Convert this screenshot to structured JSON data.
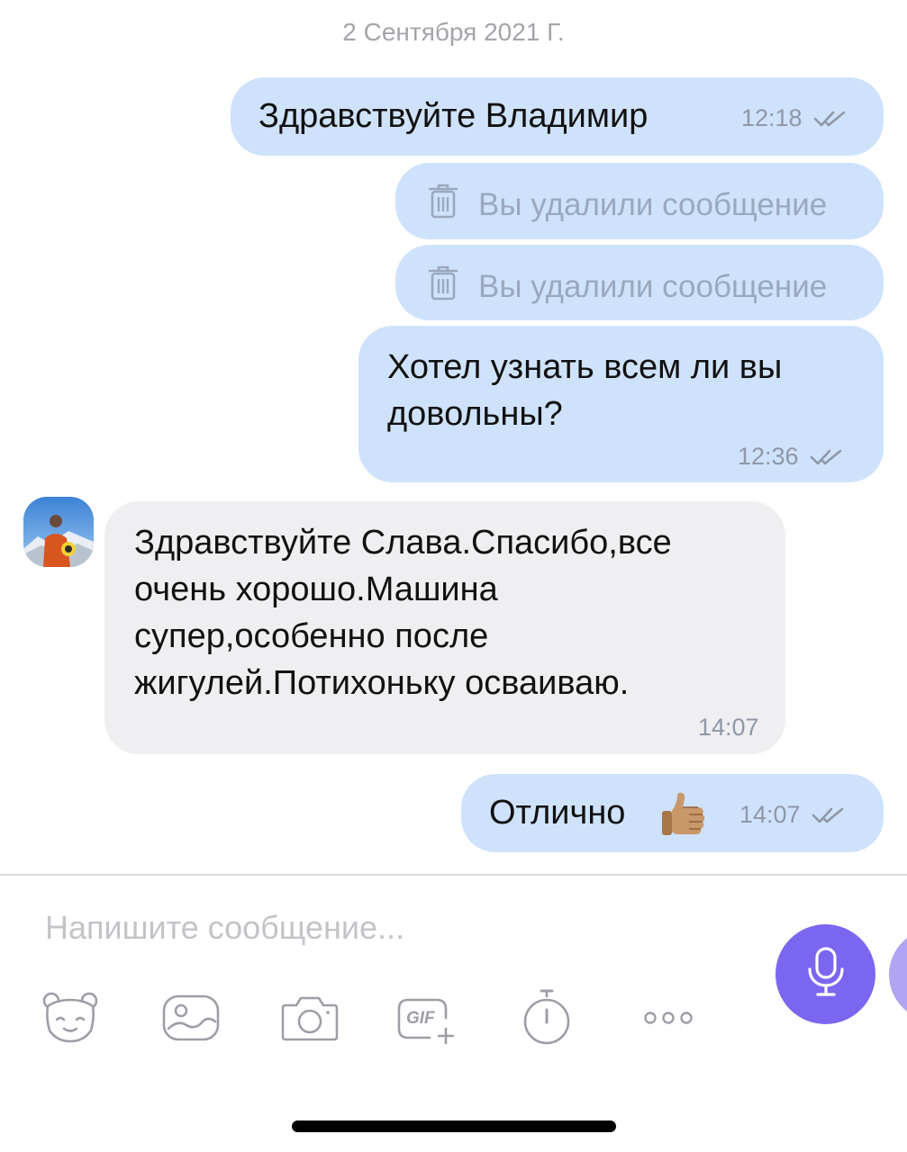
{
  "chat": {
    "date": "2 Сентября 2021 Г.",
    "messages": [
      {
        "direction": "out",
        "text": "Здравствуйте Владимир",
        "time": "12:18",
        "status": "read"
      },
      {
        "direction": "out",
        "deleted": true,
        "text": "Вы удалили сообщение"
      },
      {
        "direction": "out",
        "deleted": true,
        "text": "Вы удалили сообщение"
      },
      {
        "direction": "out",
        "lines": [
          "Хотел узнать всем ли вы",
          "довольны?"
        ],
        "time": "12:36",
        "status": "read"
      },
      {
        "direction": "in",
        "lines": [
          "Здравствуйте Слава.Спасибо,все",
          "очень хорошо.Машина",
          "супер,особенно после",
          "жигулей.Потихоньку осваиваю."
        ],
        "time": "14:07"
      },
      {
        "direction": "out",
        "text": "Отлично",
        "emoji": "thumbs-up",
        "time": "14:07",
        "status": "read"
      }
    ]
  },
  "composer": {
    "placeholder": "Напишите сообщение...",
    "toolbar": [
      "sticker-icon",
      "gallery-icon",
      "camera-icon",
      "gif-icon",
      "timer-icon",
      "more-icon"
    ],
    "gif_label": "GIF",
    "mic": "microphone-icon"
  },
  "colors": {
    "outgoing_bubble": "#cfe2fc",
    "incoming_bubble": "#efeff1",
    "accent": "#7b66f0"
  }
}
